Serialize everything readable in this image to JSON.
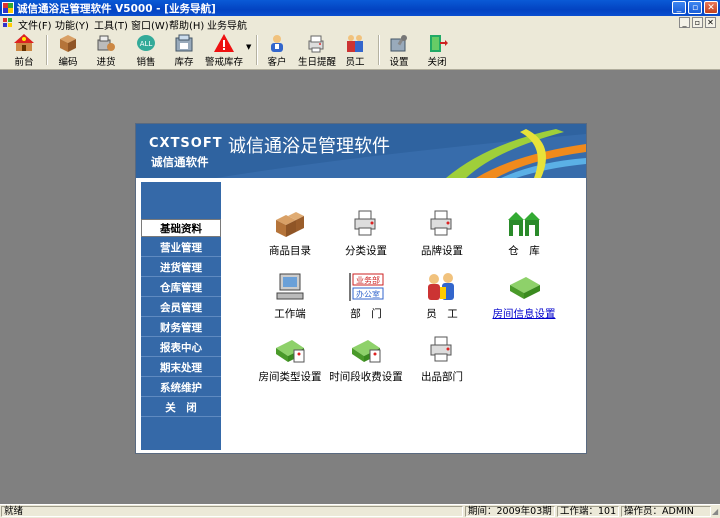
{
  "window": {
    "title": "诚信通浴足管理软件 V5000 - [业务导航]"
  },
  "menu": [
    "文件(F)",
    "功能(Y)",
    "工具(T)",
    "窗口(W)",
    "帮助(H)",
    "业务导航"
  ],
  "toolbar": {
    "items": [
      {
        "label": "前台",
        "icon": "front-desk-icon"
      },
      {
        "label": "编码",
        "icon": "box-icon"
      },
      {
        "label": "进货",
        "icon": "purchase-icon"
      },
      {
        "label": "销售",
        "icon": "sales-icon"
      },
      {
        "label": "库存",
        "icon": "inventory-icon"
      },
      {
        "label": "警戒库存",
        "icon": "warning-icon"
      },
      {
        "label": "客户",
        "icon": "customer-icon"
      },
      {
        "label": "生日提醒",
        "icon": "birthday-icon"
      },
      {
        "label": "员工",
        "icon": "employees-icon"
      },
      {
        "label": "设置",
        "icon": "settings-icon"
      },
      {
        "label": "关闭",
        "icon": "exit-icon"
      }
    ]
  },
  "banner": {
    "brand_en": "CXTSOFT",
    "brand_cn": "诚信通软件",
    "app_title": "诚信通浴足管理软件"
  },
  "sidebar": {
    "items": [
      {
        "label": "基础资料",
        "active": true
      },
      {
        "label": "营业管理"
      },
      {
        "label": "进货管理"
      },
      {
        "label": "仓库管理"
      },
      {
        "label": "会员管理"
      },
      {
        "label": "财务管理"
      },
      {
        "label": "报表中心"
      },
      {
        "label": "期末处理"
      },
      {
        "label": "系统维护"
      },
      {
        "label": "关　闭"
      }
    ]
  },
  "functions": [
    {
      "label": "商品目录",
      "icon": "boxes-icon"
    },
    {
      "label": "分类设置",
      "icon": "printer-icon"
    },
    {
      "label": "品牌设置",
      "icon": "printer-icon"
    },
    {
      "label": "仓　库",
      "icon": "warehouse-icon"
    },
    {
      "label": "工作端",
      "icon": "computer-icon"
    },
    {
      "label": "部　门",
      "icon": "department-icon"
    },
    {
      "label": "员　工",
      "icon": "employees-icon"
    },
    {
      "label": "房间信息设置",
      "icon": "room-icon",
      "link": true
    },
    {
      "label": "房间类型设置",
      "icon": "room-type-icon"
    },
    {
      "label": "时间段收费设置",
      "icon": "time-fee-icon"
    },
    {
      "label": "出品部门",
      "icon": "printer-icon"
    }
  ],
  "department_icon_text": [
    "业务部",
    "办公室"
  ],
  "status": {
    "ready": "就绪",
    "period": "期间：2009年03期",
    "terminal": "工作端：101",
    "operator": "操作员：ADMIN"
  },
  "colors": {
    "titlebar": "#0343c2",
    "sidebar": "#3569a8",
    "banner": "#2a5c96",
    "chrome": "#ece9d8",
    "workspace": "#808080"
  }
}
